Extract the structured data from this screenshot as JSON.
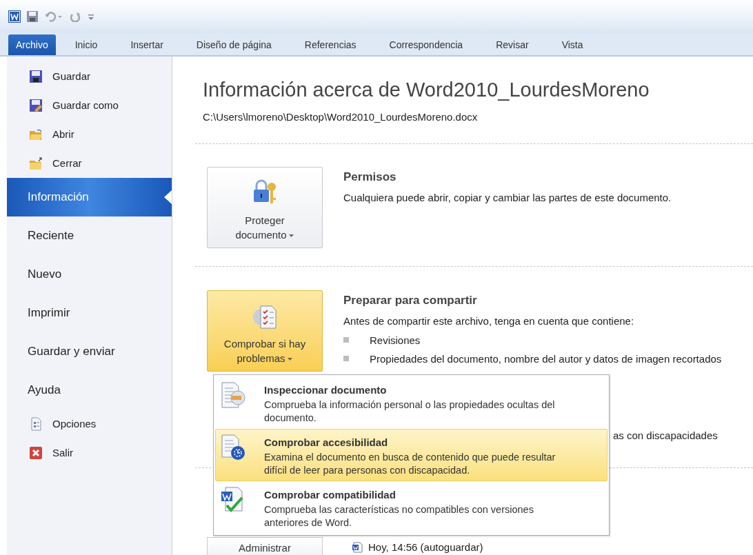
{
  "ribbon_tabs": [
    {
      "label": "Archivo",
      "selected": true
    },
    {
      "label": "Inicio",
      "selected": false
    },
    {
      "label": "Insertar",
      "selected": false
    },
    {
      "label": "Diseño de página",
      "selected": false
    },
    {
      "label": "Referencias",
      "selected": false
    },
    {
      "label": "Correspondencia",
      "selected": false
    },
    {
      "label": "Revisar",
      "selected": false
    },
    {
      "label": "Vista",
      "selected": false
    }
  ],
  "sidebar": {
    "items": [
      {
        "label": "Guardar",
        "kind": "command",
        "selected": false
      },
      {
        "label": "Guardar como",
        "kind": "command",
        "selected": false
      },
      {
        "label": "Abrir",
        "kind": "command",
        "selected": false
      },
      {
        "label": "Cerrar",
        "kind": "command",
        "selected": false
      },
      {
        "label": "Información",
        "kind": "section",
        "selected": true
      },
      {
        "label": "Reciente",
        "kind": "section",
        "selected": false
      },
      {
        "label": "Nuevo",
        "kind": "section",
        "selected": false
      },
      {
        "label": "Imprimir",
        "kind": "section",
        "selected": false
      },
      {
        "label": "Guardar y enviar",
        "kind": "section",
        "selected": false
      },
      {
        "label": "Ayuda",
        "kind": "section",
        "selected": false
      },
      {
        "label": "Opciones",
        "kind": "command",
        "selected": false
      },
      {
        "label": "Salir",
        "kind": "command",
        "selected": false
      }
    ]
  },
  "info": {
    "title": "Información acerca de Word2010_LourdesMoreno",
    "path": "C:\\Users\\lmoreno\\Desktop\\Word2010_LourdesMoreno.docx",
    "sections": [
      {
        "button": "Proteger documento",
        "highlighted": false,
        "heading": "Permisos",
        "description": "Cualquiera puede abrir, copiar y cambiar las partes de este documento."
      },
      {
        "button": "Comprobar si hay problemas",
        "highlighted": true,
        "heading": "Preparar para compartir",
        "description": "Antes de compartir este archivo, tenga en cuenta que contiene:",
        "bullets": [
          "Revisiones",
          "Propiedades del documento, nombre del autor y datos de imagen recortados"
        ],
        "obscured_text": "as con discapacidades"
      }
    ],
    "versions": {
      "button": "Administrar",
      "entries": [
        "Hoy, 14:56 (autoguardar)"
      ]
    }
  },
  "dropdown": {
    "items": [
      {
        "title": "Inspeccionar documento",
        "description": "Comprueba la información personal o las propiedades ocultas del documento.",
        "selected": false
      },
      {
        "title": "Comprobar accesibilidad",
        "description": "Examina el documento en busca de contenido que puede resultar difícil de leer para personas con discapacidad.",
        "selected": true
      },
      {
        "title": "Comprobar compatibilidad",
        "description": "Comprueba las características no compatibles con versiones anteriores de Word.",
        "selected": false
      }
    ]
  }
}
